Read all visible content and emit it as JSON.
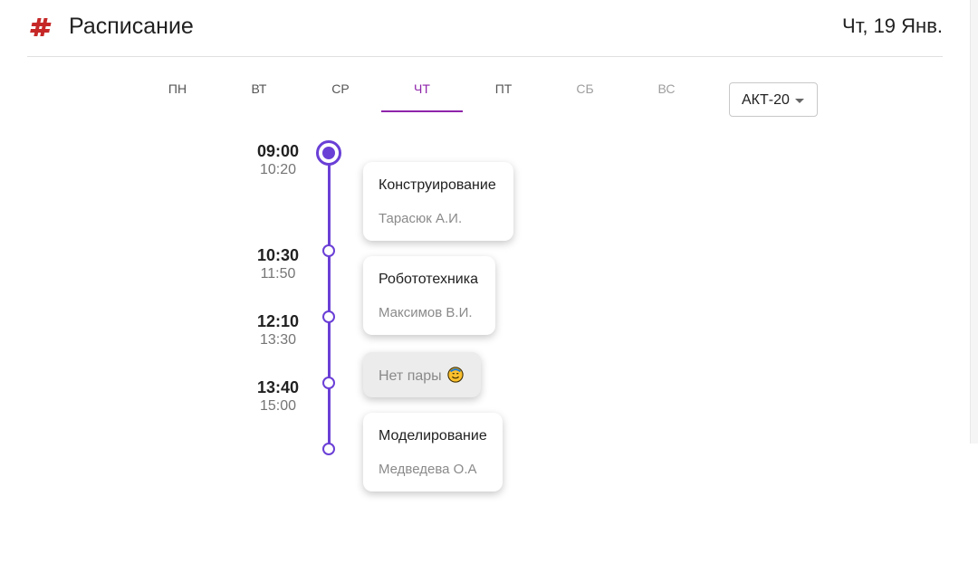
{
  "header": {
    "title": "Расписание",
    "date": "Чт, 19 Янв.",
    "logo_icon": "hash-icon"
  },
  "tabs": [
    {
      "label": "ПН"
    },
    {
      "label": "ВТ"
    },
    {
      "label": "СР"
    },
    {
      "label": "ЧТ",
      "active": true
    },
    {
      "label": "ПТ"
    },
    {
      "label": "СБ",
      "disabled": true
    },
    {
      "label": "ВС",
      "disabled": true
    }
  ],
  "group_select": {
    "value": "АКТ-20"
  },
  "times": [
    {
      "start": "09:00",
      "end": "10:20"
    },
    {
      "start": "10:30",
      "end": "11:50"
    },
    {
      "start": "12:10",
      "end": "13:30"
    },
    {
      "start": "13:40",
      "end": "15:00"
    }
  ],
  "lessons": [
    {
      "title": "Конструирование",
      "teacher": "Тарасюк А.И."
    },
    {
      "title": "Робототехника",
      "teacher": "Максимов В.И."
    },
    {
      "title": "Нет пары",
      "emoji": "smiling-face-icon"
    },
    {
      "title": "Моделирование",
      "teacher": "Медведева О.А"
    }
  ],
  "colors": {
    "accent": "#8e24aa",
    "timeline": "#6a3fd6",
    "logo": "#c62828"
  }
}
